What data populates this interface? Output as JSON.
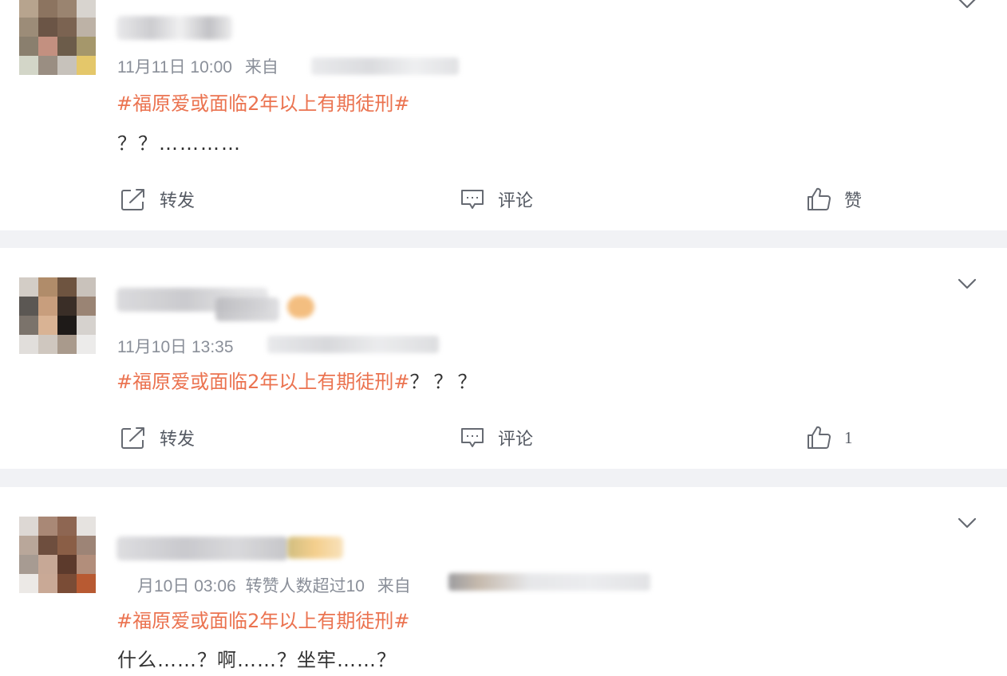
{
  "posts": [
    {
      "meta": {
        "time": "11月11日 10:00",
        "source_prefix": "来自"
      },
      "topic": "#福原爱或面临2年以上有期徒刑#",
      "body": "？？…………",
      "actions": {
        "repost_label": "转发",
        "comment_label": "评论",
        "like_label": "赞"
      }
    },
    {
      "meta": {
        "time": "11月10日 13:35"
      },
      "topic": "#福原爱或面临2年以上有期徒刑#",
      "topic_suffix": "？？？",
      "actions": {
        "repost_label": "转发",
        "comment_label": "评论",
        "like_count": "1"
      }
    },
    {
      "meta": {
        "time": "月10日 03:06",
        "flag": "转赞人数超过10",
        "source_prefix": "来自"
      },
      "topic": "#福原爱或面临2年以上有期徒刑#",
      "body": "什么……？啊……？坐牢……？"
    }
  ],
  "colors": {
    "topic": "#eb7350",
    "meta": "#8a8f99",
    "body": "#333333",
    "action": "#555a63",
    "separator": "#f1f2f5"
  },
  "icons": {
    "repost": "repost-icon",
    "comment": "comment-icon",
    "like": "thumbs-up-icon",
    "more": "chevron-down-icon"
  }
}
